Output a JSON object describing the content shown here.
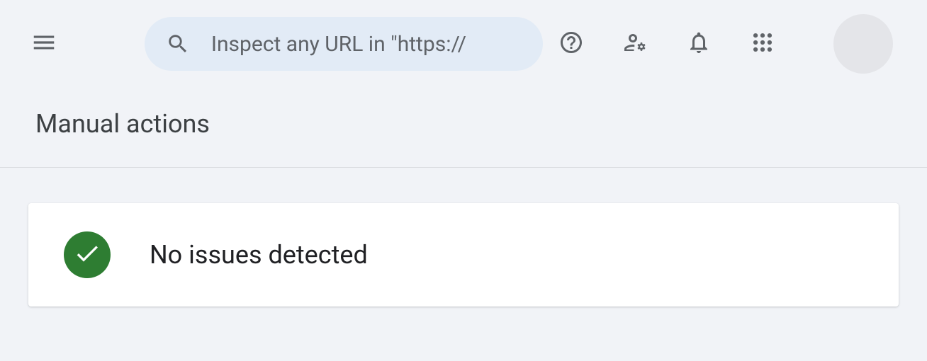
{
  "header": {
    "search_placeholder": "Inspect any URL in \"https://"
  },
  "page": {
    "title": "Manual actions"
  },
  "status": {
    "message": "No issues detected",
    "color": "#2e7d32"
  }
}
